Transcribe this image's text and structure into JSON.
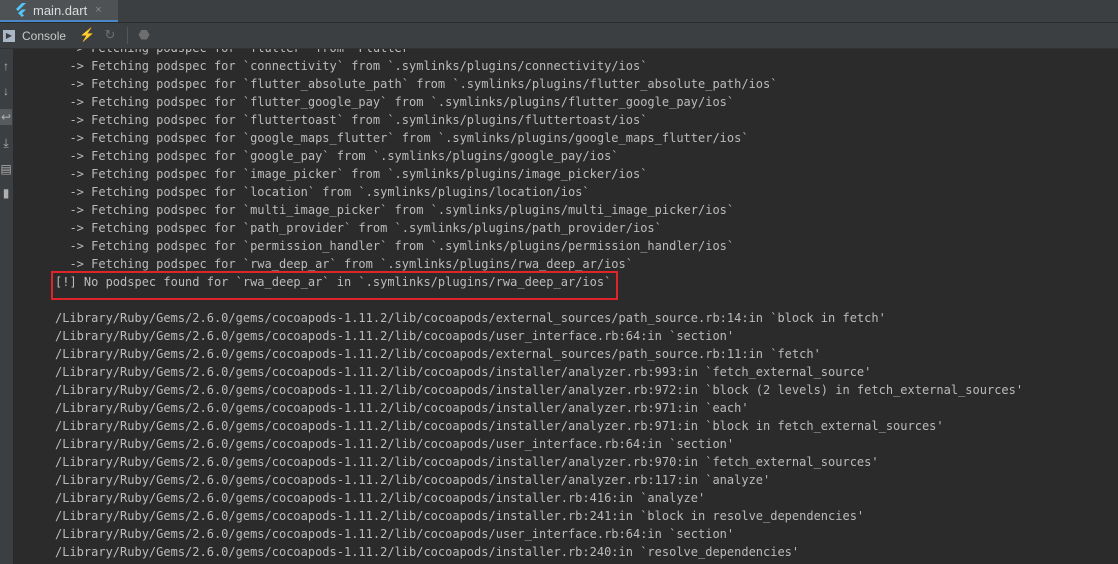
{
  "tab": {
    "title": "main.dart",
    "close": "×"
  },
  "toolbar": {
    "console_label": "Console"
  },
  "console": {
    "lines": [
      "  -> Fetching podspec for `flutter` from `Flutter`",
      "  -> Fetching podspec for `connectivity` from `.symlinks/plugins/connectivity/ios`",
      "  -> Fetching podspec for `flutter_absolute_path` from `.symlinks/plugins/flutter_absolute_path/ios`",
      "  -> Fetching podspec for `flutter_google_pay` from `.symlinks/plugins/flutter_google_pay/ios`",
      "  -> Fetching podspec for `fluttertoast` from `.symlinks/plugins/fluttertoast/ios`",
      "  -> Fetching podspec for `google_maps_flutter` from `.symlinks/plugins/google_maps_flutter/ios`",
      "  -> Fetching podspec for `google_pay` from `.symlinks/plugins/google_pay/ios`",
      "  -> Fetching podspec for `image_picker` from `.symlinks/plugins/image_picker/ios`",
      "  -> Fetching podspec for `location` from `.symlinks/plugins/location/ios`",
      "  -> Fetching podspec for `multi_image_picker` from `.symlinks/plugins/multi_image_picker/ios`",
      "  -> Fetching podspec for `path_provider` from `.symlinks/plugins/path_provider/ios`",
      "  -> Fetching podspec for `permission_handler` from `.symlinks/plugins/permission_handler/ios`",
      "  -> Fetching podspec for `rwa_deep_ar` from `.symlinks/plugins/rwa_deep_ar/ios`",
      "[!] No podspec found for `rwa_deep_ar` in `.symlinks/plugins/rwa_deep_ar/ios`",
      "",
      "/Library/Ruby/Gems/2.6.0/gems/cocoapods-1.11.2/lib/cocoapods/external_sources/path_source.rb:14:in `block in fetch'",
      "/Library/Ruby/Gems/2.6.0/gems/cocoapods-1.11.2/lib/cocoapods/user_interface.rb:64:in `section'",
      "/Library/Ruby/Gems/2.6.0/gems/cocoapods-1.11.2/lib/cocoapods/external_sources/path_source.rb:11:in `fetch'",
      "/Library/Ruby/Gems/2.6.0/gems/cocoapods-1.11.2/lib/cocoapods/installer/analyzer.rb:993:in `fetch_external_source'",
      "/Library/Ruby/Gems/2.6.0/gems/cocoapods-1.11.2/lib/cocoapods/installer/analyzer.rb:972:in `block (2 levels) in fetch_external_sources'",
      "/Library/Ruby/Gems/2.6.0/gems/cocoapods-1.11.2/lib/cocoapods/installer/analyzer.rb:971:in `each'",
      "/Library/Ruby/Gems/2.6.0/gems/cocoapods-1.11.2/lib/cocoapods/installer/analyzer.rb:971:in `block in fetch_external_sources'",
      "/Library/Ruby/Gems/2.6.0/gems/cocoapods-1.11.2/lib/cocoapods/user_interface.rb:64:in `section'",
      "/Library/Ruby/Gems/2.6.0/gems/cocoapods-1.11.2/lib/cocoapods/installer/analyzer.rb:970:in `fetch_external_sources'",
      "/Library/Ruby/Gems/2.6.0/gems/cocoapods-1.11.2/lib/cocoapods/installer/analyzer.rb:117:in `analyze'",
      "/Library/Ruby/Gems/2.6.0/gems/cocoapods-1.11.2/lib/cocoapods/installer.rb:416:in `analyze'",
      "/Library/Ruby/Gems/2.6.0/gems/cocoapods-1.11.2/lib/cocoapods/installer.rb:241:in `block in resolve_dependencies'",
      "/Library/Ruby/Gems/2.6.0/gems/cocoapods-1.11.2/lib/cocoapods/user_interface.rb:64:in `section'",
      "/Library/Ruby/Gems/2.6.0/gems/cocoapods-1.11.2/lib/cocoapods/installer.rb:240:in `resolve_dependencies'"
    ]
  },
  "colors": {
    "highlight_border": "#e0242b",
    "tab_accent": "#4a88c7",
    "flutter_icon": "#54c5f8"
  }
}
